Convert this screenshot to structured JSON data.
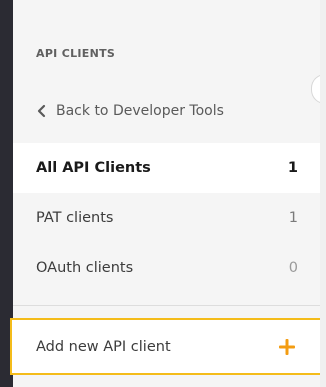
{
  "sidebar": {
    "section_title": "API CLIENTS",
    "back_link": "Back to Developer Tools",
    "items": [
      {
        "label": "All API Clients",
        "count": "1"
      },
      {
        "label": "PAT clients",
        "count": "1"
      },
      {
        "label": "OAuth clients",
        "count": "0"
      }
    ],
    "add_action": "Add new API client"
  },
  "colors": {
    "accent": "#f39c12",
    "highlight_border": "#f4bc1a",
    "left_bar": "#2b2b33"
  },
  "icons": {
    "back": "chevron-left-icon",
    "add": "plus-icon"
  }
}
